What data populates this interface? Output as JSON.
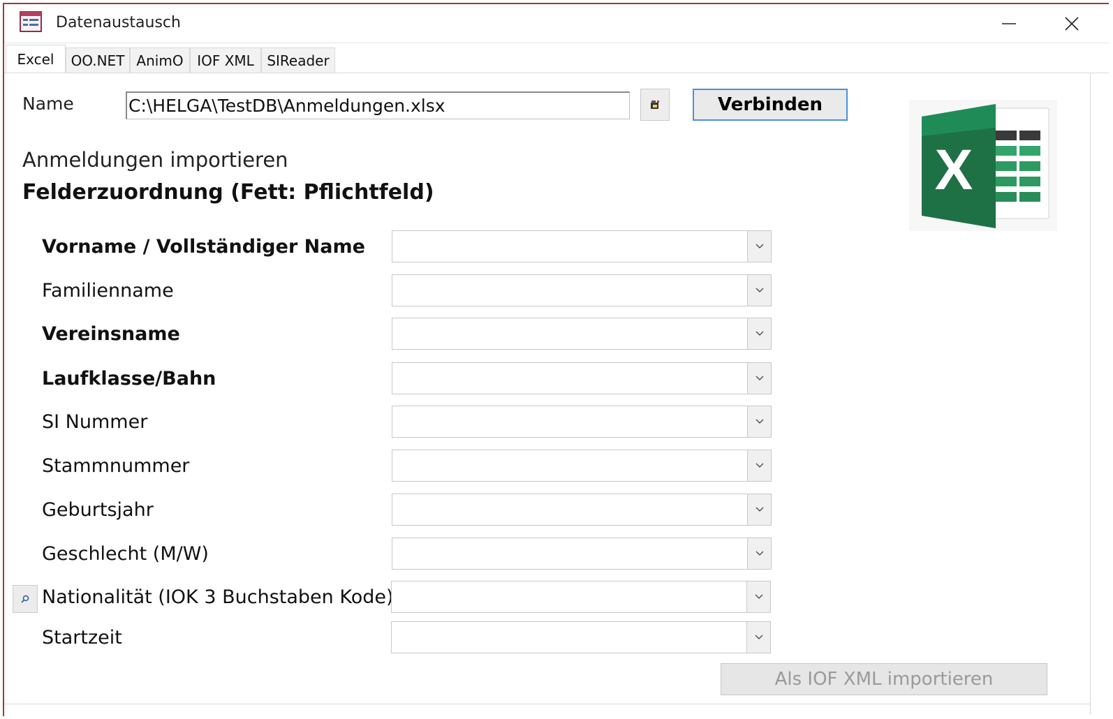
{
  "window": {
    "title": "Datenaustausch"
  },
  "tabs": [
    {
      "label": "Excel",
      "active": true
    },
    {
      "label": "OO.NET",
      "active": false
    },
    {
      "label": "AnimO",
      "active": false
    },
    {
      "label": "IOF XML",
      "active": false
    },
    {
      "label": "SIReader",
      "active": false
    }
  ],
  "file": {
    "label": "Name",
    "value": "C:\\HELGA\\TestDB\\Anmeldungen.xlsx",
    "browse_icon": "folder-browse-icon",
    "connect_label": "Verbinden"
  },
  "section": {
    "title": "Anmeldungen importieren",
    "subtitle": "Felderzuordnung (Fett: Pflichtfeld)"
  },
  "fields": [
    {
      "label": "Vorname / Vollständiger Name",
      "required": true,
      "value": ""
    },
    {
      "label": "Familienname",
      "required": false,
      "value": ""
    },
    {
      "label": "Vereinsname",
      "required": true,
      "value": ""
    },
    {
      "label": "Laufklasse/Bahn",
      "required": true,
      "value": ""
    },
    {
      "label": "SI Nummer",
      "required": false,
      "value": ""
    },
    {
      "label": "Stammnummer",
      "required": false,
      "value": ""
    },
    {
      "label": "Geburtsjahr",
      "required": false,
      "value": ""
    },
    {
      "label": "Geschlecht (M/W)",
      "required": false,
      "value": ""
    },
    {
      "label": "Nationalität (IOK 3 Buchstaben Kode)",
      "required": false,
      "value": ""
    },
    {
      "label": "Startzeit",
      "required": false,
      "value": ""
    }
  ],
  "actions": {
    "import_label": "Als IOF XML importieren",
    "import_enabled": false
  },
  "colors": {
    "excel_green": "#1e7145",
    "focus_blue": "#4a90d9",
    "window_border": "#a4373a"
  }
}
